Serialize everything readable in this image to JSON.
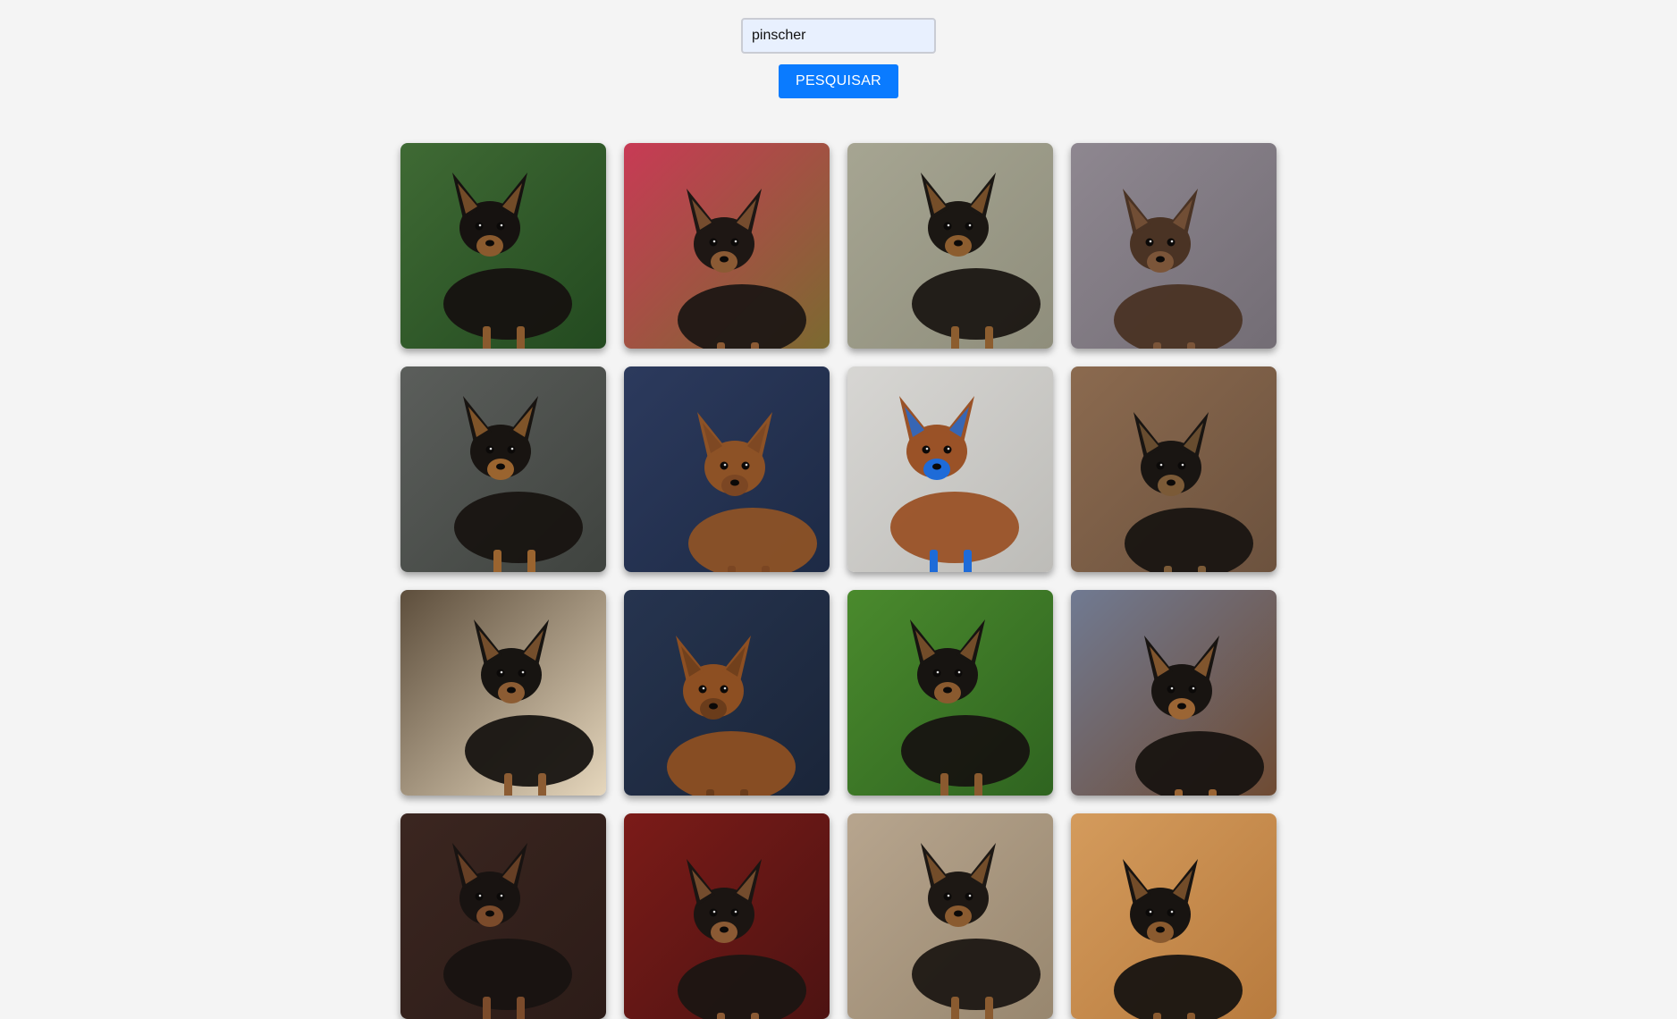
{
  "search": {
    "value": "pinscher",
    "button_label": "PESQUISAR"
  },
  "results": [
    {
      "alt": "pinscher",
      "bg": "#3f6a34",
      "bg2": "#234a20",
      "dog": "#161210",
      "tan": "#8a5a2e"
    },
    {
      "alt": "pinscher",
      "bg": "#c83a55",
      "bg2": "#7b6a30",
      "dog": "#1e1714",
      "tan": "#8b5a34"
    },
    {
      "alt": "pinscher",
      "bg": "#a6a592",
      "bg2": "#8f8e7c",
      "dog": "#1b1713",
      "tan": "#8c5d2f"
    },
    {
      "alt": "pinscher",
      "bg": "#8e8790",
      "bg2": "#736d75",
      "dog": "#4a3324",
      "tan": "#7b5539"
    },
    {
      "alt": "pinscher",
      "bg": "#5b5e5b",
      "bg2": "#3f433f",
      "dog": "#181411",
      "tan": "#9a642f"
    },
    {
      "alt": "pinscher",
      "bg": "#2c3a5d",
      "bg2": "#1d2a45",
      "dog": "#8d5226",
      "tan": "#7b4623"
    },
    {
      "alt": "pinscher",
      "bg": "#d7d6d3",
      "bg2": "#bdbcb8",
      "dog": "#9a5227",
      "tan": "#1e6bd8"
    },
    {
      "alt": "pinscher",
      "bg": "#8b6a4f",
      "bg2": "#6c523e",
      "dog": "#191512",
      "tan": "#7b5a37"
    },
    {
      "alt": "pinscher",
      "bg": "#5d4e3c",
      "bg2": "#e6d7bd",
      "dog": "#171411",
      "tan": "#8c5c33"
    },
    {
      "alt": "pinscher",
      "bg": "#26344f",
      "bg2": "#1a2539",
      "dog": "#8d4f22",
      "tan": "#6a3c1b"
    },
    {
      "alt": "pinscher",
      "bg": "#4a8a2d",
      "bg2": "#2f6420",
      "dog": "#171411",
      "tan": "#8a5a2f"
    },
    {
      "alt": "pinscher",
      "bg": "#707a92",
      "bg2": "#6f4b33",
      "dog": "#181411",
      "tan": "#9b6534"
    },
    {
      "alt": "pinscher",
      "bg": "#3b2620",
      "bg2": "#2c1c18",
      "dog": "#181311",
      "tan": "#7b4b2b"
    },
    {
      "alt": "pinscher",
      "bg": "#7b1b18",
      "bg2": "#4d1312",
      "dog": "#1b1512",
      "tan": "#8b5a34"
    },
    {
      "alt": "pinscher",
      "bg": "#b7a58e",
      "bg2": "#98876f",
      "dog": "#1d1814",
      "tan": "#8a5b30"
    },
    {
      "alt": "pinscher",
      "bg": "#d49b5c",
      "bg2": "#b87b3e",
      "dog": "#181411",
      "tan": "#8a5a2f"
    }
  ]
}
